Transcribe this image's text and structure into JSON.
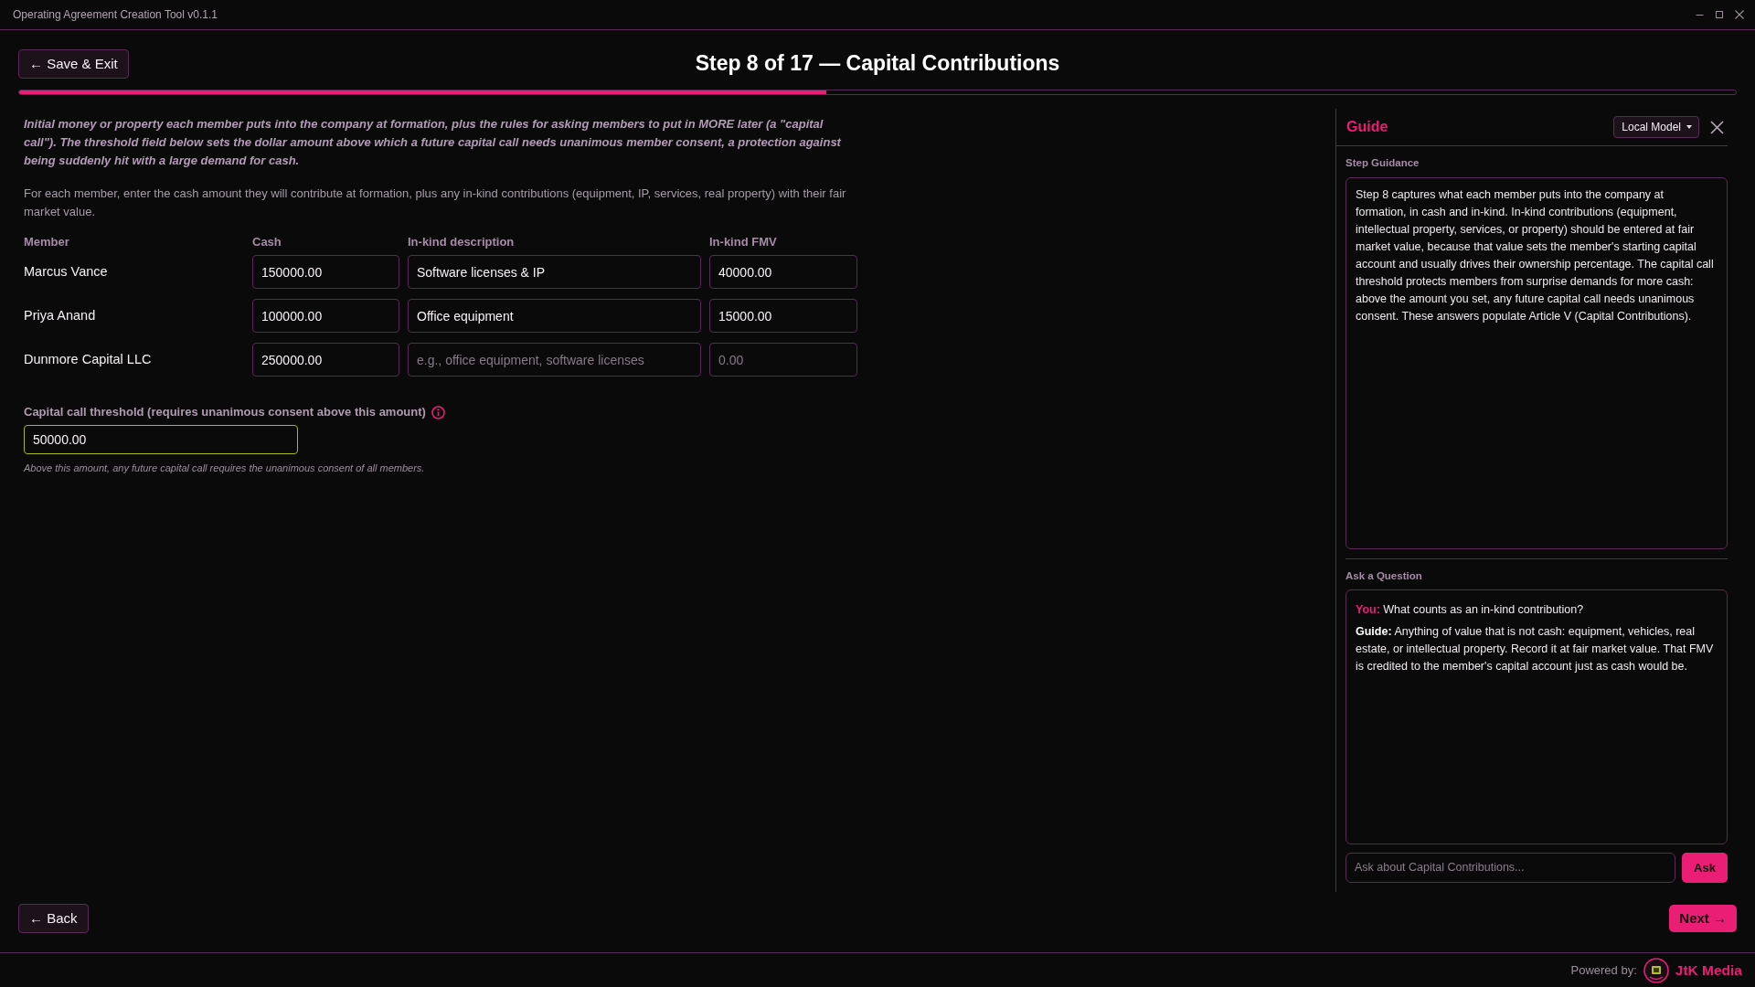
{
  "window": {
    "title": "Operating Agreement Creation Tool v0.1.1"
  },
  "header": {
    "save_exit_button": "← Save & Exit",
    "title": "Step 8 of 17 — Capital Contributions",
    "progress": {
      "level": 0.47
    }
  },
  "intro": "Initial money or property each member puts into the company at formation, plus the rules for asking members to put in MORE later (a \"capital call\"). The threshold field below sets the dollar amount above which a future capital call needs unanimous member consent, a protection against being suddenly hit with a large demand for cash.",
  "instructions": "For each member, enter the cash amount they will contribute at formation, plus any in-kind contributions (equipment, IP, services, real property) with their fair market value.",
  "contributions_table": {
    "columns": [
      "Member",
      "Cash",
      "In-kind description",
      "In-kind FMV"
    ],
    "rows": [
      {
        "member": "Marcus Vance",
        "cash": {
          "value": "150000.00"
        },
        "inkind_description": {
          "value": "Software licenses & IP"
        },
        "inkind_fmv": {
          "value": "40000.00"
        }
      },
      {
        "member": "Priya Anand",
        "cash": {
          "value": "100000.00"
        },
        "inkind_description": {
          "value": "Office equipment"
        },
        "inkind_fmv": {
          "value": "15000.00"
        }
      },
      {
        "member": "Dunmore Capital LLC",
        "cash": {
          "value": "250000.00"
        },
        "inkind_description": {
          "placeholder": "e.g., office equipment, software licenses"
        },
        "inkind_fmv": {
          "placeholder": "0.00"
        }
      }
    ]
  },
  "threshold": {
    "label": "Capital call threshold (requires unanimous consent above this amount)",
    "value": "50000.00",
    "focused": true,
    "hint": "Above this amount, any future capital call requires the unanimous consent of all members."
  },
  "guide": {
    "title": "Guide",
    "model_dropdown": "Local Model",
    "step_guidance": {
      "label": "Step Guidance",
      "text": "Step 8 captures what each member puts into the company at formation, in cash and in-kind. In-kind contributions (equipment, intellectual property, services, or property) should be entered at fair market value, because that value sets the member's starting capital account and usually drives their ownership percentage. The capital call threshold protects members from surprise demands for more cash: above the amount you set, any future capital call needs unanimous consent. These answers populate Article V (Capital Contributions)."
    },
    "ask": {
      "label": "Ask a Question",
      "messages": [
        {
          "kind": "user",
          "speaker": "You:",
          "text": "What counts as an in-kind contribution?"
        },
        {
          "kind": "guide",
          "speaker": "Guide:",
          "text": "Anything of value that is not cash: equipment, vehicles, real estate, or intellectual property. Record it at fair market value. That FMV is credited to the member's capital account just as cash would be."
        }
      ],
      "input": {
        "placeholder": "Ask about Capital Contributions..."
      },
      "ask_button": "Ask"
    }
  },
  "navigation": {
    "back_button": "← Back",
    "next_button": "Next →"
  },
  "footer": {
    "powered_by": "Powered by:",
    "brand": "JtK Media"
  }
}
